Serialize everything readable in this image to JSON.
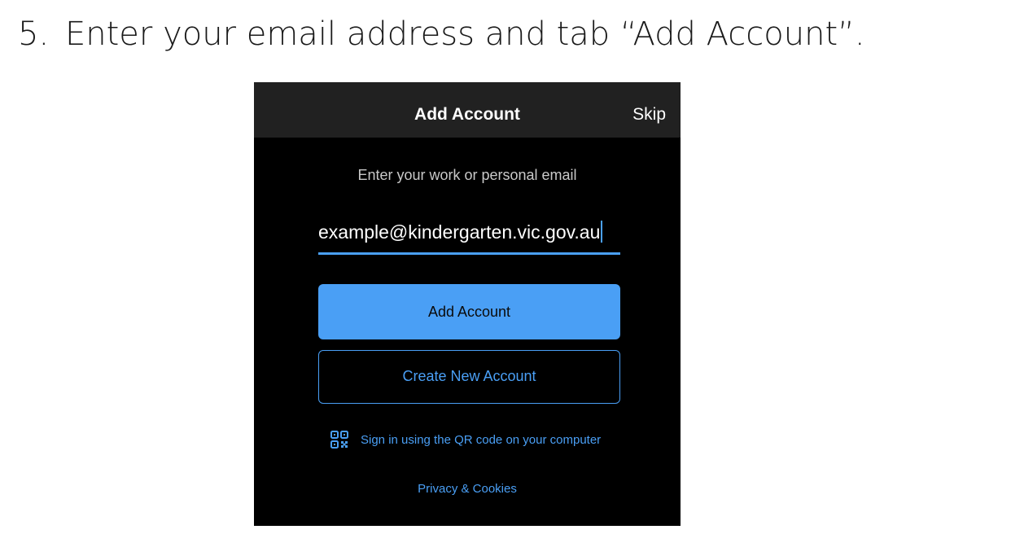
{
  "instruction": {
    "number": "5.",
    "text": "Enter your email address and tab “Add Account”."
  },
  "screen": {
    "nav": {
      "title": "Add Account",
      "skip_label": "Skip"
    },
    "prompt": "Enter your work or personal email",
    "email": {
      "value": "example@kindergarten.vic.gov.au"
    },
    "add_account_label": "Add Account",
    "create_account_label": "Create New Account",
    "qr_link": {
      "icon": "qr-code-icon",
      "label": "Sign in using the QR code on your computer"
    },
    "privacy_label": "Privacy & Cookies"
  },
  "colors": {
    "accent": "#4a9ff5",
    "background": "#000000",
    "navbar": "#212121"
  }
}
